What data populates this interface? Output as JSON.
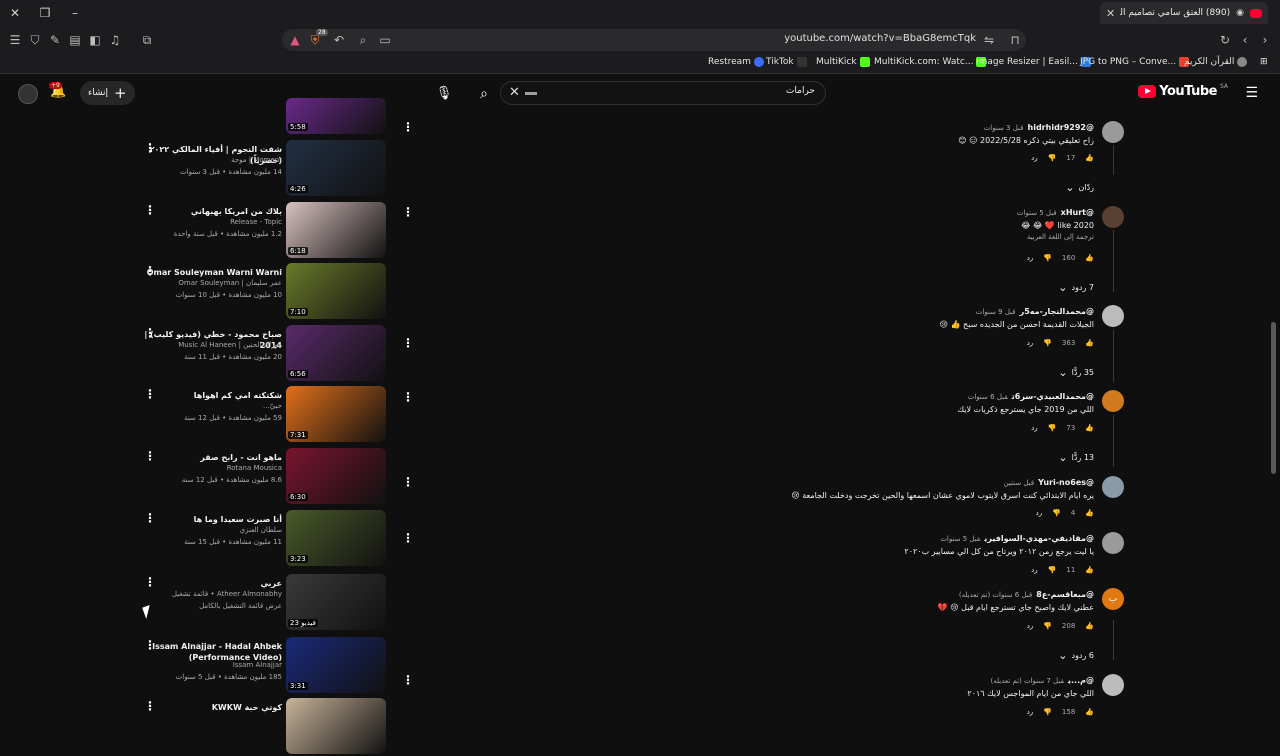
{
  "browser": {
    "tab_title": "(890) العتق سامي تصاميم الم...",
    "url": "youtube.com/watch?v=BbaG8emcTqk",
    "shield_badge": "28",
    "bookmarks": [
      {
        "label": "Restream",
        "color": "#3b6cff"
      },
      {
        "label": "TikTok",
        "color": "#111111"
      },
      {
        "label": "MultiKick",
        "color": "#53fc18"
      },
      {
        "label": "MultiKick.com: Watc...",
        "color": "#53fc18"
      },
      {
        "label": "Image Resizer | Easil...",
        "color": "#2f7bd8"
      },
      {
        "label": "JPG to PNG – Conve...",
        "color": "#e8402f"
      },
      {
        "label": "القرآن الكريم",
        "color": "#888888"
      }
    ]
  },
  "header": {
    "logo_text": "YouTube",
    "logo_country": "SA",
    "search_query": "حرامات",
    "create_label": "إنشاء",
    "bell_badge": "+9"
  },
  "related": [
    {
      "title": "",
      "channel": "",
      "meta": "",
      "duration": "5:58",
      "thumb": "#6a2a8a"
    },
    {
      "title": "شفت النجوم | أفياء المالكي ٢٠٢٢ (حصرياً)",
      "channel": "Moment | موجة",
      "meta": "14 مليون مشاهدة • قبل 3 سنوات",
      "duration": "4:26",
      "thumb": "#223044"
    },
    {
      "title": "بلاك من امريكا بهبهاني",
      "channel": "Release - Topic",
      "meta": "1.2 مليون مشاهدة • قبل سنة واحدة",
      "duration": "6:18",
      "thumb": "#d8c2c0"
    },
    {
      "title": "Omar Souleyman Warni Warni",
      "channel": "عمر سليمان | Omar Souleyman",
      "meta": "10 مليون مشاهدة • قبل 10 سنوات",
      "duration": "7:10",
      "thumb": "#6b7a2b"
    },
    {
      "title": "صباح محمود - خطي (فيديو كليب) | 2014",
      "channel": "موزاك الحنين | Music Al Haneen",
      "meta": "20 مليون مشاهدة • قبل 11 سنة",
      "duration": "6:56",
      "thumb": "#5a2a6a"
    },
    {
      "title": "شكتكته امي كم اهواها",
      "channel": "حبيّ...",
      "meta": "59 مليون مشاهدة • قبل 12 سنة",
      "duration": "7:31",
      "thumb": "#e2701a"
    },
    {
      "title": "ماهو انت - رابح صقر",
      "channel": "Rotana Mousica",
      "meta": "8.6 مليون مشاهدة • قبل 12 سنة",
      "duration": "6:30",
      "thumb": "#7a1430"
    },
    {
      "title": "أنا صبرت سعيدا وما ها",
      "channel": "سلطان العنزي",
      "meta": "11 مليون مشاهدة • قبل 15 سنة",
      "duration": "3:23",
      "thumb": "#4a5a2a"
    },
    {
      "title": "عربي",
      "channel": "Atheer Almonabhy • قائمة تشغيل",
      "meta": "عرض قائمة التشغيل بالكامل",
      "duration": "23 فيديو",
      "thumb": "#3a3a3a"
    },
    {
      "title": "Issam Alnajjar - Hadal Ahbek (Performance Video)",
      "channel": "Issam Alnajjar",
      "meta": "185 مليون مشاهدة • قبل 5 سنوات",
      "duration": "3:31",
      "thumb": "#1a2a7a"
    },
    {
      "title": "كوتي حبة KWKW",
      "channel": "",
      "meta": "",
      "duration": "",
      "thumb": "#c8b49a"
    }
  ],
  "comments": [
    {
      "author": "@hidrhidr9292",
      "time": "قبل 3 سنوات",
      "text": "زاح تعليقي بيتي ذكره 2022/5/28 😑 😊",
      "translate": "",
      "likes": "17",
      "avatar": "#9a9a9a"
    },
    {
      "author": "@xHurt",
      "time": "قبل 5 سنوات",
      "text": "2020 like ❤️ 😂 😂",
      "translate": "ترجمة إلى اللغة العربية",
      "likes": "160",
      "avatar": "#5a4030"
    },
    {
      "author": "@محمدالنجار-مه5ر",
      "time": "قبل 9 سنوات",
      "text": "الجيلات القديمة احسن من الجديده سبح 👍 😢",
      "translate": "",
      "likes": "363",
      "avatar": "#bbbbbb"
    },
    {
      "author": "@محمدالعبيدي-سر6ت",
      "time": "قبل 6 سنوات",
      "text": "اللي من 2019 جاي يسترجع ذكريات لايك",
      "translate": "",
      "likes": "73",
      "avatar": "#d07a20"
    },
    {
      "author": "@Yuri-no6es",
      "time": "قبل سنتين",
      "text": "يره ايام الابتدائي كنت اسرق لايتوب لاموي عشان اسمعها والحين تخرجت ودخلت الجامعة 😢",
      "translate": "",
      "likes": "4",
      "avatar": "#8a9aa8"
    },
    {
      "author": "@مقاديفي-مهدي-السوافيري",
      "time": "قبل 5 سنوات",
      "text": "يا ليت يرجع زمن ٢٠١٢ ويرتاح من كل الي مسايير ب٢٠٢٠",
      "translate": "",
      "likes": "11",
      "avatar": "#9a9a9a"
    },
    {
      "author": "@مبعاقسم-ع8",
      "time": "قبل 6 سنوات (تم تعديله)",
      "text": "عطني لايك واصبح جاي تسترجع ايام قبل 😢 💔",
      "translate": "",
      "likes": "208",
      "avatar": "#e07a10",
      "avatar_letter": "ب"
    },
    {
      "author": "@م...ي",
      "time": "قبل 7 سنوات (تم تعديله)",
      "text": "اللي جاي من ايام المواجس لايك ٢٠١٦",
      "translate": "",
      "likes": "158",
      "avatar": "#bcbcbc"
    }
  ],
  "labels": {
    "reply": "رد",
    "more_replies_0": "ردّان",
    "more_replies_1": "7 ردود",
    "more_replies_2": "35 ردًّا",
    "more_replies_3": "13 ردًّا",
    "more_replies_4": "6 ردود"
  }
}
